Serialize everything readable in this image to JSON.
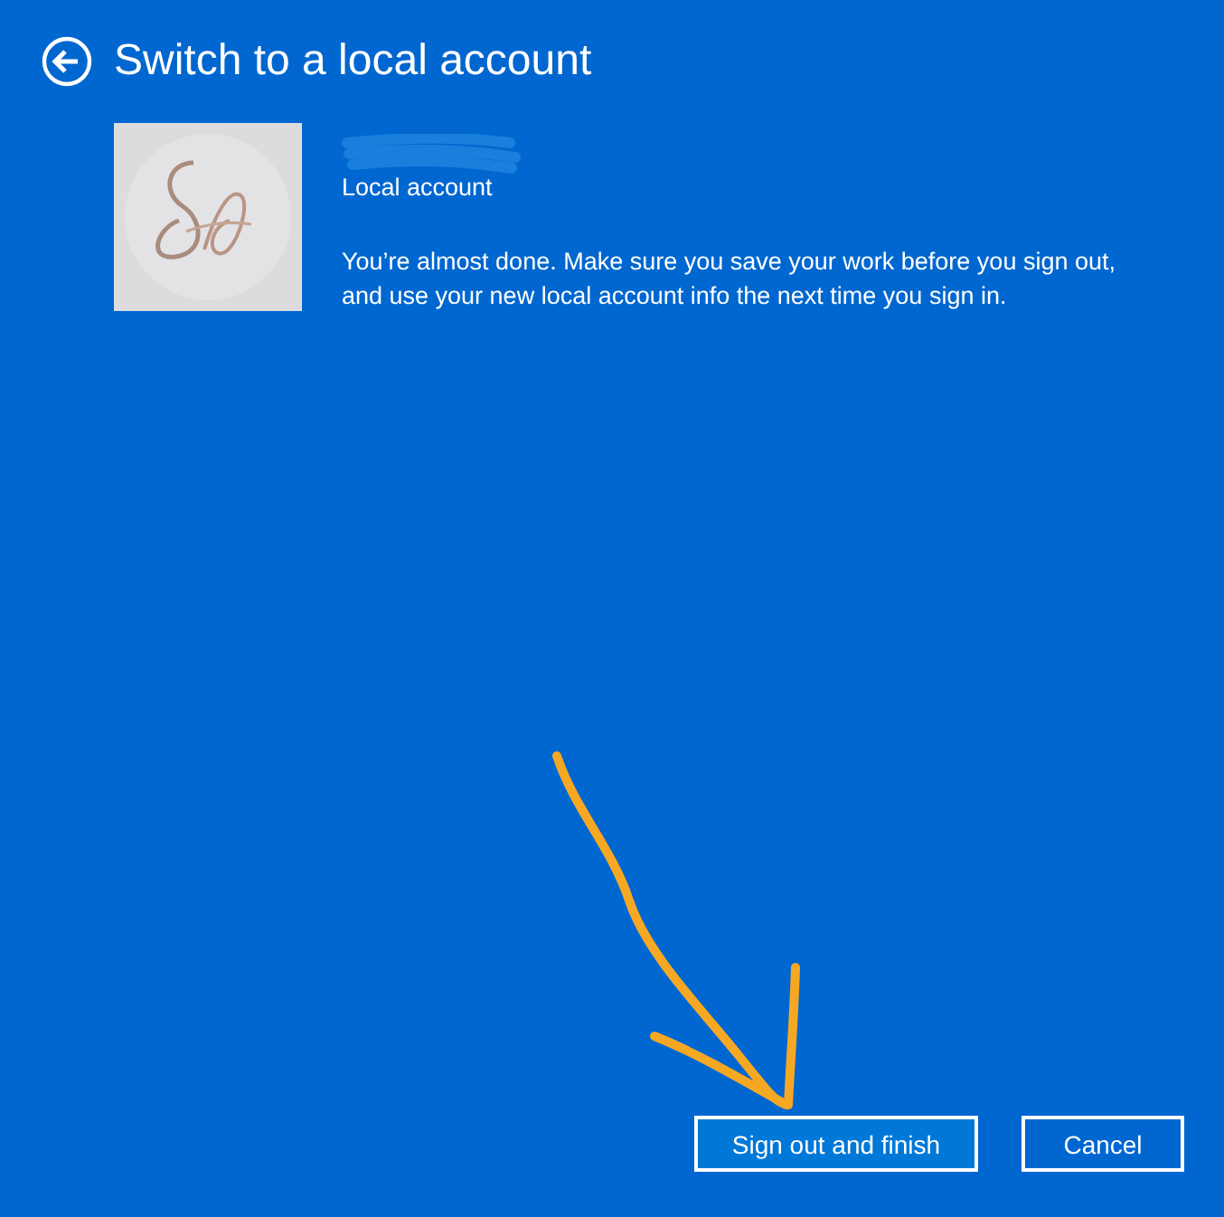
{
  "header": {
    "title": "Switch to a local account"
  },
  "account": {
    "type": "Local account",
    "message": "You’re almost done. Make sure you save your work before you sign out, and use your new local account info the next time you sign in."
  },
  "buttons": [
    {
      "label": "Sign out and finish",
      "primary": true
    },
    {
      "label": "Cancel",
      "primary": false
    }
  ]
}
